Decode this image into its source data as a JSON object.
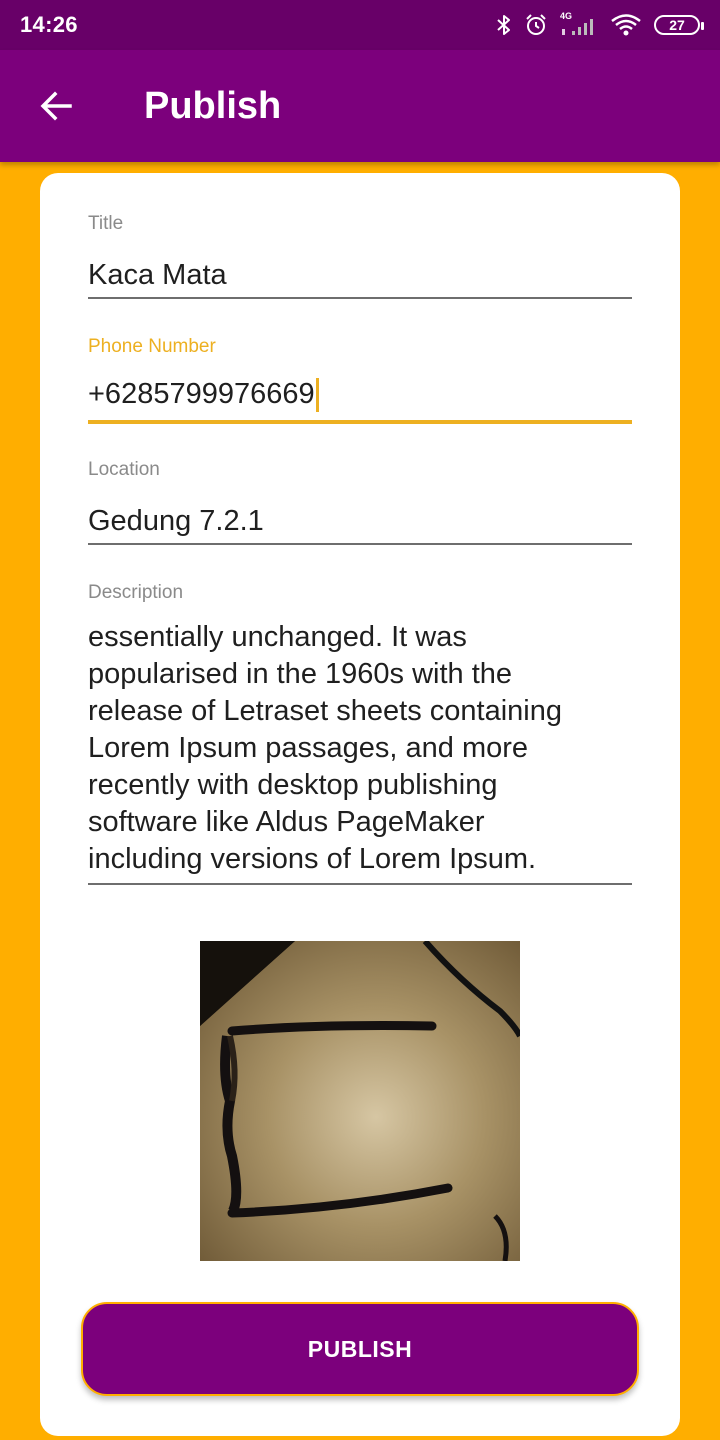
{
  "status_bar": {
    "time": "14:26",
    "network": "4G",
    "battery": "27",
    "icons": [
      "bluetooth-icon",
      "alarm-icon",
      "signal-icon",
      "wifi-icon",
      "battery-icon"
    ]
  },
  "app_bar": {
    "title": "Publish",
    "back_icon": "arrow-back-icon"
  },
  "form": {
    "title": {
      "label": "Title",
      "value": "Kaca Mata"
    },
    "phone": {
      "label": "Phone Number",
      "value": "+6285799976669"
    },
    "location": {
      "label": "Location",
      "value": "Gedung 7.2.1"
    },
    "description": {
      "label": "Description",
      "lines": [
        "essentially unchanged. It was",
        "popularised in the 1960s with the",
        "release of Letraset sheets containing",
        "Lorem Ipsum passages, and more",
        "recently with desktop publishing",
        "software like Aldus PageMaker",
        "including versions of Lorem Ipsum."
      ]
    }
  },
  "photo": {
    "subject": "eyeglasses-photo"
  },
  "publish_button": {
    "label": "PUBLISH"
  },
  "colors": {
    "status_bar": "#680068",
    "app_bar": "#7C007C",
    "background": "#FFAE00",
    "accent": "#EDB021",
    "button": "#7C007C"
  }
}
